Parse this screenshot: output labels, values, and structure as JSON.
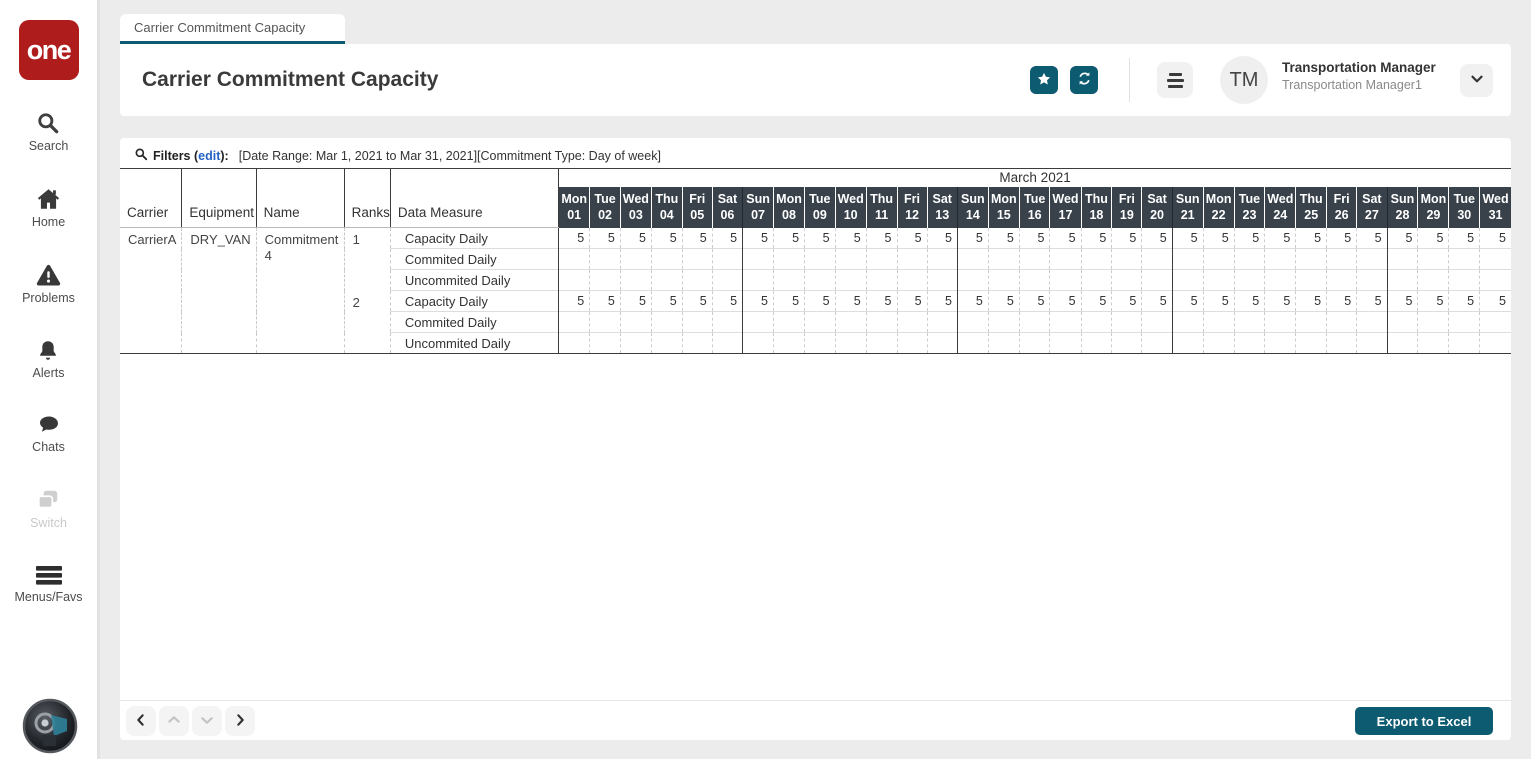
{
  "brand": {
    "logo_text": "one"
  },
  "colors": {
    "accent_teal": "#0d5b71",
    "logo_red": "#ae1c1c",
    "day_header_bg": "#39424b",
    "link_blue": "#2563c4"
  },
  "sidebar": {
    "items": [
      {
        "label": "Search",
        "icon": "search-icon",
        "disabled": false
      },
      {
        "label": "Home",
        "icon": "home-icon",
        "disabled": false
      },
      {
        "label": "Problems",
        "icon": "warning-icon",
        "disabled": false
      },
      {
        "label": "Alerts",
        "icon": "bell-icon",
        "disabled": false
      },
      {
        "label": "Chats",
        "icon": "chat-icon",
        "disabled": false
      },
      {
        "label": "Switch",
        "icon": "switch-icon",
        "disabled": true
      },
      {
        "label": "Menus/Favs",
        "icon": "menu-icon",
        "disabled": false
      }
    ]
  },
  "tab": {
    "label": "Carrier Commitment Capacity"
  },
  "header": {
    "title": "Carrier Commitment Capacity",
    "actions": {
      "favorite": "star-icon",
      "refresh": "refresh-icon"
    },
    "user": {
      "initials": "TM",
      "name": "Transportation Manager",
      "subtitle": "Transportation Manager1"
    }
  },
  "filters": {
    "prefix": "Filters (",
    "edit_label": "edit",
    "suffix": "):",
    "summary": "[Date Range: Mar 1, 2021 to Mar 31, 2021][Commitment Type: Day of week]"
  },
  "table": {
    "month_label": "March 2021",
    "left_columns": [
      "Carrier",
      "Equipment",
      "Name",
      "Ranks",
      "Data Measure"
    ],
    "days": [
      {
        "dow": "Mon",
        "num": "01"
      },
      {
        "dow": "Tue",
        "num": "02"
      },
      {
        "dow": "Wed",
        "num": "03"
      },
      {
        "dow": "Thu",
        "num": "04"
      },
      {
        "dow": "Fri",
        "num": "05"
      },
      {
        "dow": "Sat",
        "num": "06"
      },
      {
        "dow": "Sun",
        "num": "07"
      },
      {
        "dow": "Mon",
        "num": "08"
      },
      {
        "dow": "Tue",
        "num": "09"
      },
      {
        "dow": "Wed",
        "num": "10"
      },
      {
        "dow": "Thu",
        "num": "11"
      },
      {
        "dow": "Fri",
        "num": "12"
      },
      {
        "dow": "Sat",
        "num": "13"
      },
      {
        "dow": "Sun",
        "num": "14"
      },
      {
        "dow": "Mon",
        "num": "15"
      },
      {
        "dow": "Tue",
        "num": "16"
      },
      {
        "dow": "Wed",
        "num": "17"
      },
      {
        "dow": "Thu",
        "num": "18"
      },
      {
        "dow": "Fri",
        "num": "19"
      },
      {
        "dow": "Sat",
        "num": "20"
      },
      {
        "dow": "Sun",
        "num": "21"
      },
      {
        "dow": "Mon",
        "num": "22"
      },
      {
        "dow": "Tue",
        "num": "23"
      },
      {
        "dow": "Wed",
        "num": "24"
      },
      {
        "dow": "Thu",
        "num": "25"
      },
      {
        "dow": "Fri",
        "num": "26"
      },
      {
        "dow": "Sat",
        "num": "27"
      },
      {
        "dow": "Sun",
        "num": "28"
      },
      {
        "dow": "Mon",
        "num": "29"
      },
      {
        "dow": "Tue",
        "num": "30"
      },
      {
        "dow": "Wed",
        "num": "31"
      }
    ],
    "group": {
      "carrier": "CarrierA",
      "equipment": "DRY_VAN",
      "name": "Commitment 4",
      "ranks": [
        {
          "rank": "1",
          "measures": [
            {
              "label": "Capacity Daily",
              "values": [
                "5",
                "5",
                "5",
                "5",
                "5",
                "5",
                "5",
                "5",
                "5",
                "5",
                "5",
                "5",
                "5",
                "5",
                "5",
                "5",
                "5",
                "5",
                "5",
                "5",
                "5",
                "5",
                "5",
                "5",
                "5",
                "5",
                "5",
                "5",
                "5",
                "5",
                "5"
              ]
            },
            {
              "label": "Commited Daily",
              "values": [
                "",
                "",
                "",
                "",
                "",
                "",
                "",
                "",
                "",
                "",
                "",
                "",
                "",
                "",
                "",
                "",
                "",
                "",
                "",
                "",
                "",
                "",
                "",
                "",
                "",
                "",
                "",
                "",
                "",
                "",
                ""
              ]
            },
            {
              "label": "Uncommited Daily",
              "values": [
                "",
                "",
                "",
                "",
                "",
                "",
                "",
                "",
                "",
                "",
                "",
                "",
                "",
                "",
                "",
                "",
                "",
                "",
                "",
                "",
                "",
                "",
                "",
                "",
                "",
                "",
                "",
                "",
                "",
                "",
                ""
              ]
            }
          ]
        },
        {
          "rank": "2",
          "measures": [
            {
              "label": "Capacity Daily",
              "values": [
                "5",
                "5",
                "5",
                "5",
                "5",
                "5",
                "5",
                "5",
                "5",
                "5",
                "5",
                "5",
                "5",
                "5",
                "5",
                "5",
                "5",
                "5",
                "5",
                "5",
                "5",
                "5",
                "5",
                "5",
                "5",
                "5",
                "5",
                "5",
                "5",
                "5",
                "5"
              ]
            },
            {
              "label": "Commited Daily",
              "values": [
                "",
                "",
                "",
                "",
                "",
                "",
                "",
                "",
                "",
                "",
                "",
                "",
                "",
                "",
                "",
                "",
                "",
                "",
                "",
                "",
                "",
                "",
                "",
                "",
                "",
                "",
                "",
                "",
                "",
                "",
                ""
              ]
            },
            {
              "label": "Uncommited Daily",
              "values": [
                "",
                "",
                "",
                "",
                "",
                "",
                "",
                "",
                "",
                "",
                "",
                "",
                "",
                "",
                "",
                "",
                "",
                "",
                "",
                "",
                "",
                "",
                "",
                "",
                "",
                "",
                "",
                "",
                "",
                "",
                ""
              ]
            }
          ]
        }
      ]
    }
  },
  "footer": {
    "export_label": "Export to Excel"
  }
}
